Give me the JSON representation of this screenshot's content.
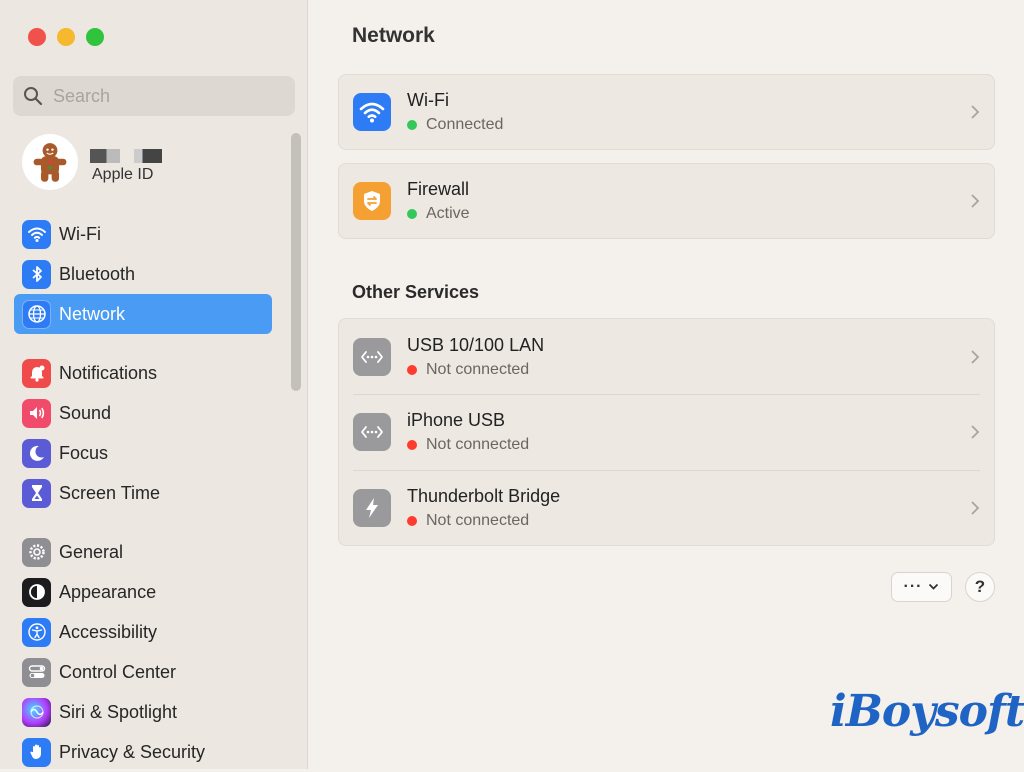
{
  "window": {
    "traffic_lights": [
      "close",
      "minimize",
      "zoom"
    ]
  },
  "sidebar": {
    "search_placeholder": "Search",
    "account": {
      "label": "Apple ID",
      "avatar_icon": "gingerbread-avatar"
    },
    "groups": [
      [
        {
          "id": "wifi",
          "label": "Wi-Fi",
          "icon": "wifi-icon",
          "color": "#2d7cf6",
          "selected": false
        },
        {
          "id": "bluetooth",
          "label": "Bluetooth",
          "icon": "bluetooth-icon",
          "color": "#2d7cf6",
          "selected": false
        },
        {
          "id": "network",
          "label": "Network",
          "icon": "globe-icon",
          "color": "#2d7cf6",
          "selected": true
        }
      ],
      [
        {
          "id": "notifications",
          "label": "Notifications",
          "icon": "bell-icon",
          "color": "#f04b4b",
          "selected": false
        },
        {
          "id": "sound",
          "label": "Sound",
          "icon": "speaker-icon",
          "color": "#f04b6b",
          "selected": false
        },
        {
          "id": "focus",
          "label": "Focus",
          "icon": "moon-icon",
          "color": "#5b5bd6",
          "selected": false
        },
        {
          "id": "screen-time",
          "label": "Screen Time",
          "icon": "hourglass-icon",
          "color": "#5b5bd6",
          "selected": false
        }
      ],
      [
        {
          "id": "general",
          "label": "General",
          "icon": "gear-icon",
          "color": "#8e8e93",
          "selected": false
        },
        {
          "id": "appearance",
          "label": "Appearance",
          "icon": "appearance-icon",
          "color": "#1c1c1e",
          "selected": false
        },
        {
          "id": "accessibility",
          "label": "Accessibility",
          "icon": "accessibility-icon",
          "color": "#2d7cf6",
          "selected": false
        },
        {
          "id": "control-center",
          "label": "Control Center",
          "icon": "toggles-icon",
          "color": "#8e8e93",
          "selected": false
        },
        {
          "id": "siri-spotlight",
          "label": "Siri & Spotlight",
          "icon": "siri-icon",
          "color": "#6b2fbf",
          "selected": false
        },
        {
          "id": "privacy-security",
          "label": "Privacy & Security",
          "icon": "hand-icon",
          "color": "#2d7cf6",
          "selected": false
        }
      ]
    ]
  },
  "main": {
    "title": "Network",
    "primary_services": [
      {
        "id": "wifi",
        "name": "Wi-Fi",
        "status": "Connected",
        "status_color": "#34c759",
        "icon": "wifi-icon",
        "icon_color": "#2d7cf6"
      },
      {
        "id": "firewall",
        "name": "Firewall",
        "status": "Active",
        "status_color": "#34c759",
        "icon": "firewall-shield-icon",
        "icon_color": "#f5a033"
      }
    ],
    "other_services_title": "Other Services",
    "other_services": [
      {
        "id": "usb-lan",
        "name": "USB 10/100 LAN",
        "status": "Not connected",
        "status_color": "#ff3b30",
        "icon": "ethernet-icon",
        "icon_color": "#9a9a9c"
      },
      {
        "id": "iphone-usb",
        "name": "iPhone USB",
        "status": "Not connected",
        "status_color": "#ff3b30",
        "icon": "ethernet-icon",
        "icon_color": "#9a9a9c"
      },
      {
        "id": "thunderbolt",
        "name": "Thunderbolt Bridge",
        "status": "Not connected",
        "status_color": "#ff3b30",
        "icon": "thunderbolt-icon",
        "icon_color": "#9a9a9c"
      }
    ],
    "more_button": {
      "label": "···",
      "icon": "chevron-down-icon"
    },
    "help_button": {
      "label": "?"
    }
  },
  "watermark": {
    "text": "iBoysoft"
  }
}
